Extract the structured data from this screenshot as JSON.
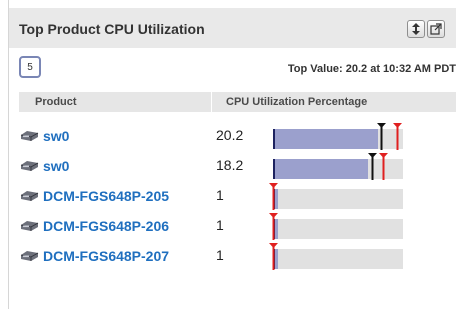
{
  "widget": {
    "title": "Top Product CPU Utilization",
    "count": "5",
    "top_value": "Top Value: 20.2 at 10:32 AM PDT",
    "buttons": {
      "move": "move-icon",
      "popout": "popout-icon"
    }
  },
  "columns": {
    "product": "Product",
    "cpu": "CPU Utilization Percentage"
  },
  "scale_max_percent": 25,
  "rows": [
    {
      "name": "sw0",
      "value": "20.2",
      "bar_percent": 20.2,
      "avg_marker_percent": 20.9,
      "max_marker_percent": 24.0
    },
    {
      "name": "sw0",
      "value": "18.2",
      "bar_percent": 18.2,
      "avg_marker_percent": 19.2,
      "max_marker_percent": 21.3
    },
    {
      "name": "DCM-FGS648P-205",
      "value": "1",
      "bar_percent": 1,
      "avg_marker_percent": 1,
      "max_marker_percent": 1
    },
    {
      "name": "DCM-FGS648P-206",
      "value": "1",
      "bar_percent": 1,
      "avg_marker_percent": 1,
      "max_marker_percent": 1
    },
    {
      "name": "DCM-FGS648P-207",
      "value": "1",
      "bar_percent": 1,
      "avg_marker_percent": 1,
      "max_marker_percent": 1
    }
  ],
  "colors": {
    "link": "#1f6fbf",
    "bar_fill": "#9ba0cd",
    "bar_track": "#e1e1e1",
    "max_marker": "#e02020",
    "avg_marker": "#111111"
  }
}
